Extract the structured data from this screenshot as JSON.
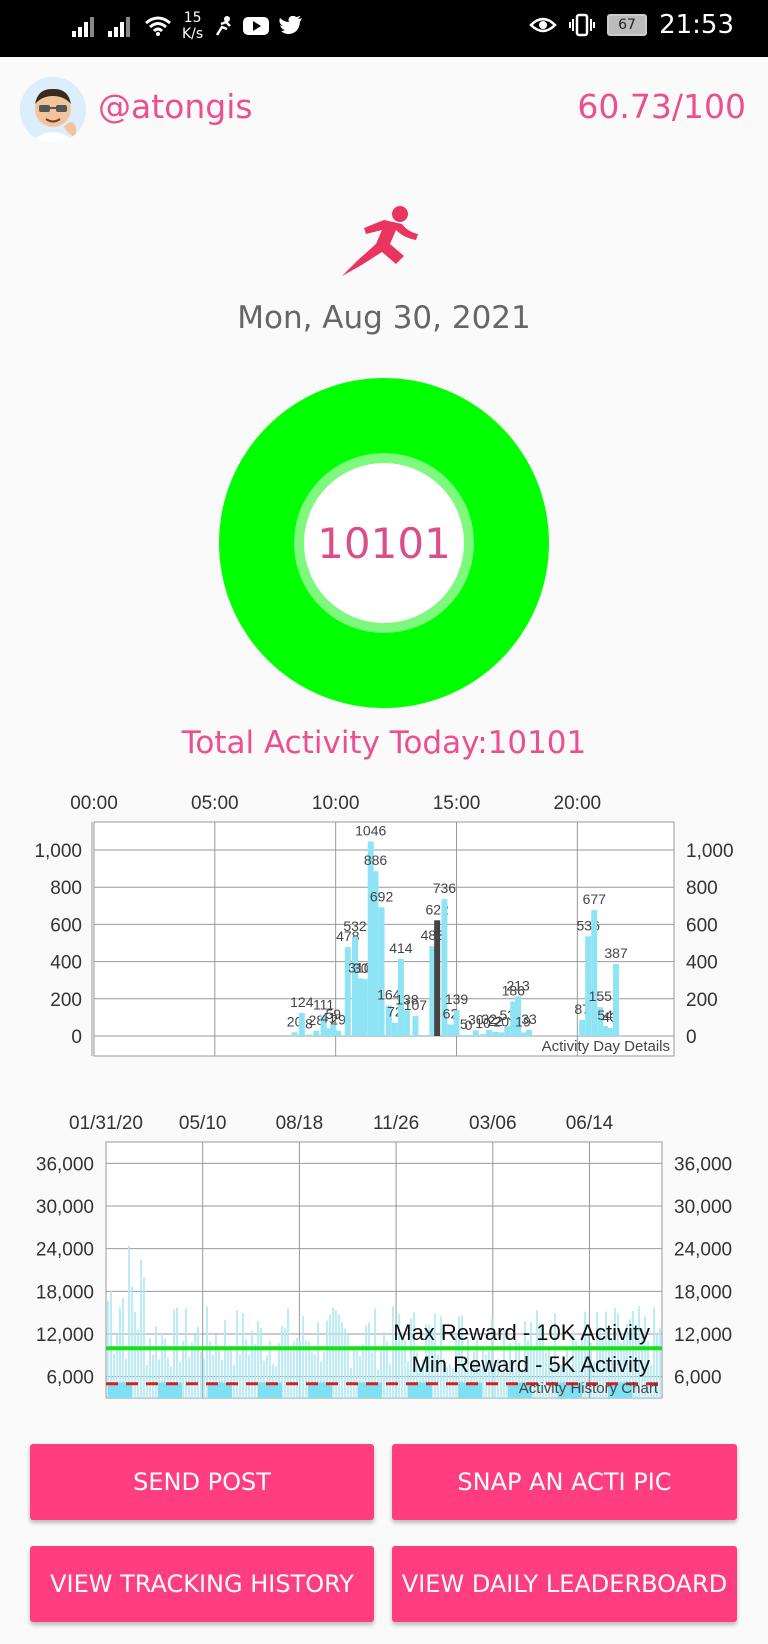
{
  "status_bar": {
    "speed_value": "15",
    "speed_unit": "K/s",
    "battery": "67",
    "time": "21:53"
  },
  "header": {
    "username": "@atongis",
    "score": "60.73/100"
  },
  "date": "Mon, Aug 30, 2021",
  "ring_value": "10101",
  "total_activity": "Total Activity Today:10101",
  "colors": {
    "accent": "#ec4f8e",
    "ring": "#00ff00",
    "bar": "#8ee4f5",
    "button": "#ff3d7f"
  },
  "chart_data": [
    {
      "type": "bar",
      "title": "Activity Day Details",
      "x_tick_labels": [
        "00:00",
        "05:00",
        "10:00",
        "15:00",
        "20:00"
      ],
      "y_ticks": [
        "1,000",
        "800",
        "600",
        "400",
        "200",
        "0"
      ],
      "ylim": [
        0,
        1100
      ],
      "grid": true,
      "bars": [
        {
          "x": 8.3,
          "v": 20,
          "label": "20"
        },
        {
          "x": 8.6,
          "v": 124,
          "label": "124"
        },
        {
          "x": 8.9,
          "v": 8,
          "label": "8"
        },
        {
          "x": 9.2,
          "v": 28,
          "label": "28"
        },
        {
          "x": 9.5,
          "v": 111,
          "label": "111"
        },
        {
          "x": 9.7,
          "v": 41,
          "label": "41"
        },
        {
          "x": 9.9,
          "v": 59,
          "label": "59"
        },
        {
          "x": 10.1,
          "v": 29,
          "label": "29"
        },
        {
          "x": 10.5,
          "v": 478,
          "label": "478"
        },
        {
          "x": 10.8,
          "v": 532,
          "label": "532"
        },
        {
          "x": 11.0,
          "v": 310,
          "label": "310"
        },
        {
          "x": 11.2,
          "v": 307,
          "label": "307"
        },
        {
          "x": 11.45,
          "v": 1046,
          "label": "1046"
        },
        {
          "x": 11.65,
          "v": 886,
          "label": "886"
        },
        {
          "x": 11.9,
          "v": 692,
          "label": "692"
        },
        {
          "x": 12.2,
          "v": 164,
          "label": "164"
        },
        {
          "x": 12.45,
          "v": 72,
          "label": "72"
        },
        {
          "x": 12.7,
          "v": 414,
          "label": "414"
        },
        {
          "x": 12.95,
          "v": 138,
          "label": "138"
        },
        {
          "x": 13.3,
          "v": 107,
          "label": "107"
        },
        {
          "x": 14.0,
          "v": 483,
          "label": "483"
        },
        {
          "x": 14.2,
          "v": 622,
          "label": "622"
        },
        {
          "x": 14.5,
          "v": 736,
          "label": "736"
        },
        {
          "x": 14.75,
          "v": 62,
          "label": "62"
        },
        {
          "x": 15.0,
          "v": 139,
          "label": "139"
        },
        {
          "x": 15.3,
          "v": 5,
          "label": "5"
        },
        {
          "x": 15.5,
          "v": 0,
          "label": "0"
        },
        {
          "x": 15.8,
          "v": 30,
          "label": "30"
        },
        {
          "x": 16.1,
          "v": 10,
          "label": "10"
        },
        {
          "x": 16.35,
          "v": 32,
          "label": "32"
        },
        {
          "x": 16.6,
          "v": 22,
          "label": "22"
        },
        {
          "x": 16.85,
          "v": 20,
          "label": "20"
        },
        {
          "x": 17.1,
          "v": 53,
          "label": "53"
        },
        {
          "x": 17.35,
          "v": 186,
          "label": "186"
        },
        {
          "x": 17.55,
          "v": 213,
          "label": "213"
        },
        {
          "x": 17.75,
          "v": 19,
          "label": "19"
        },
        {
          "x": 18.0,
          "v": 33,
          "label": "33"
        },
        {
          "x": 20.2,
          "v": 87,
          "label": "87"
        },
        {
          "x": 20.45,
          "v": 536,
          "label": "536"
        },
        {
          "x": 20.7,
          "v": 677,
          "label": "677"
        },
        {
          "x": 20.95,
          "v": 155,
          "label": "155"
        },
        {
          "x": 21.15,
          "v": 54,
          "label": "54"
        },
        {
          "x": 21.35,
          "v": 43,
          "label": "43"
        },
        {
          "x": 21.6,
          "v": 387,
          "label": "387"
        }
      ],
      "highlight_x": 14.2
    },
    {
      "type": "area",
      "title": "Activity History Chart",
      "x_tick_labels": [
        "01/31/20",
        "05/10",
        "08/18",
        "11/26",
        "03/06",
        "06/14"
      ],
      "y_ticks": [
        "36,000",
        "30,000",
        "24,000",
        "18,000",
        "12,000",
        "6,000"
      ],
      "ylim": [
        3000,
        39000
      ],
      "grid": true,
      "reference_lines": [
        {
          "label": "Max Reward - 10K Activity",
          "value": 10000,
          "color": "#16e016",
          "style": "solid"
        },
        {
          "label": "Min Reward - 5K Activity",
          "value": 5000,
          "color": "#d42020",
          "style": "dashed"
        }
      ]
    }
  ],
  "buttons": {
    "send_post": "SEND POST",
    "snap_pic": "SNAP AN ACTI PIC",
    "view_history": "VIEW TRACKING HISTORY",
    "view_leaderboard": "VIEW DAILY LEADERBOARD"
  }
}
